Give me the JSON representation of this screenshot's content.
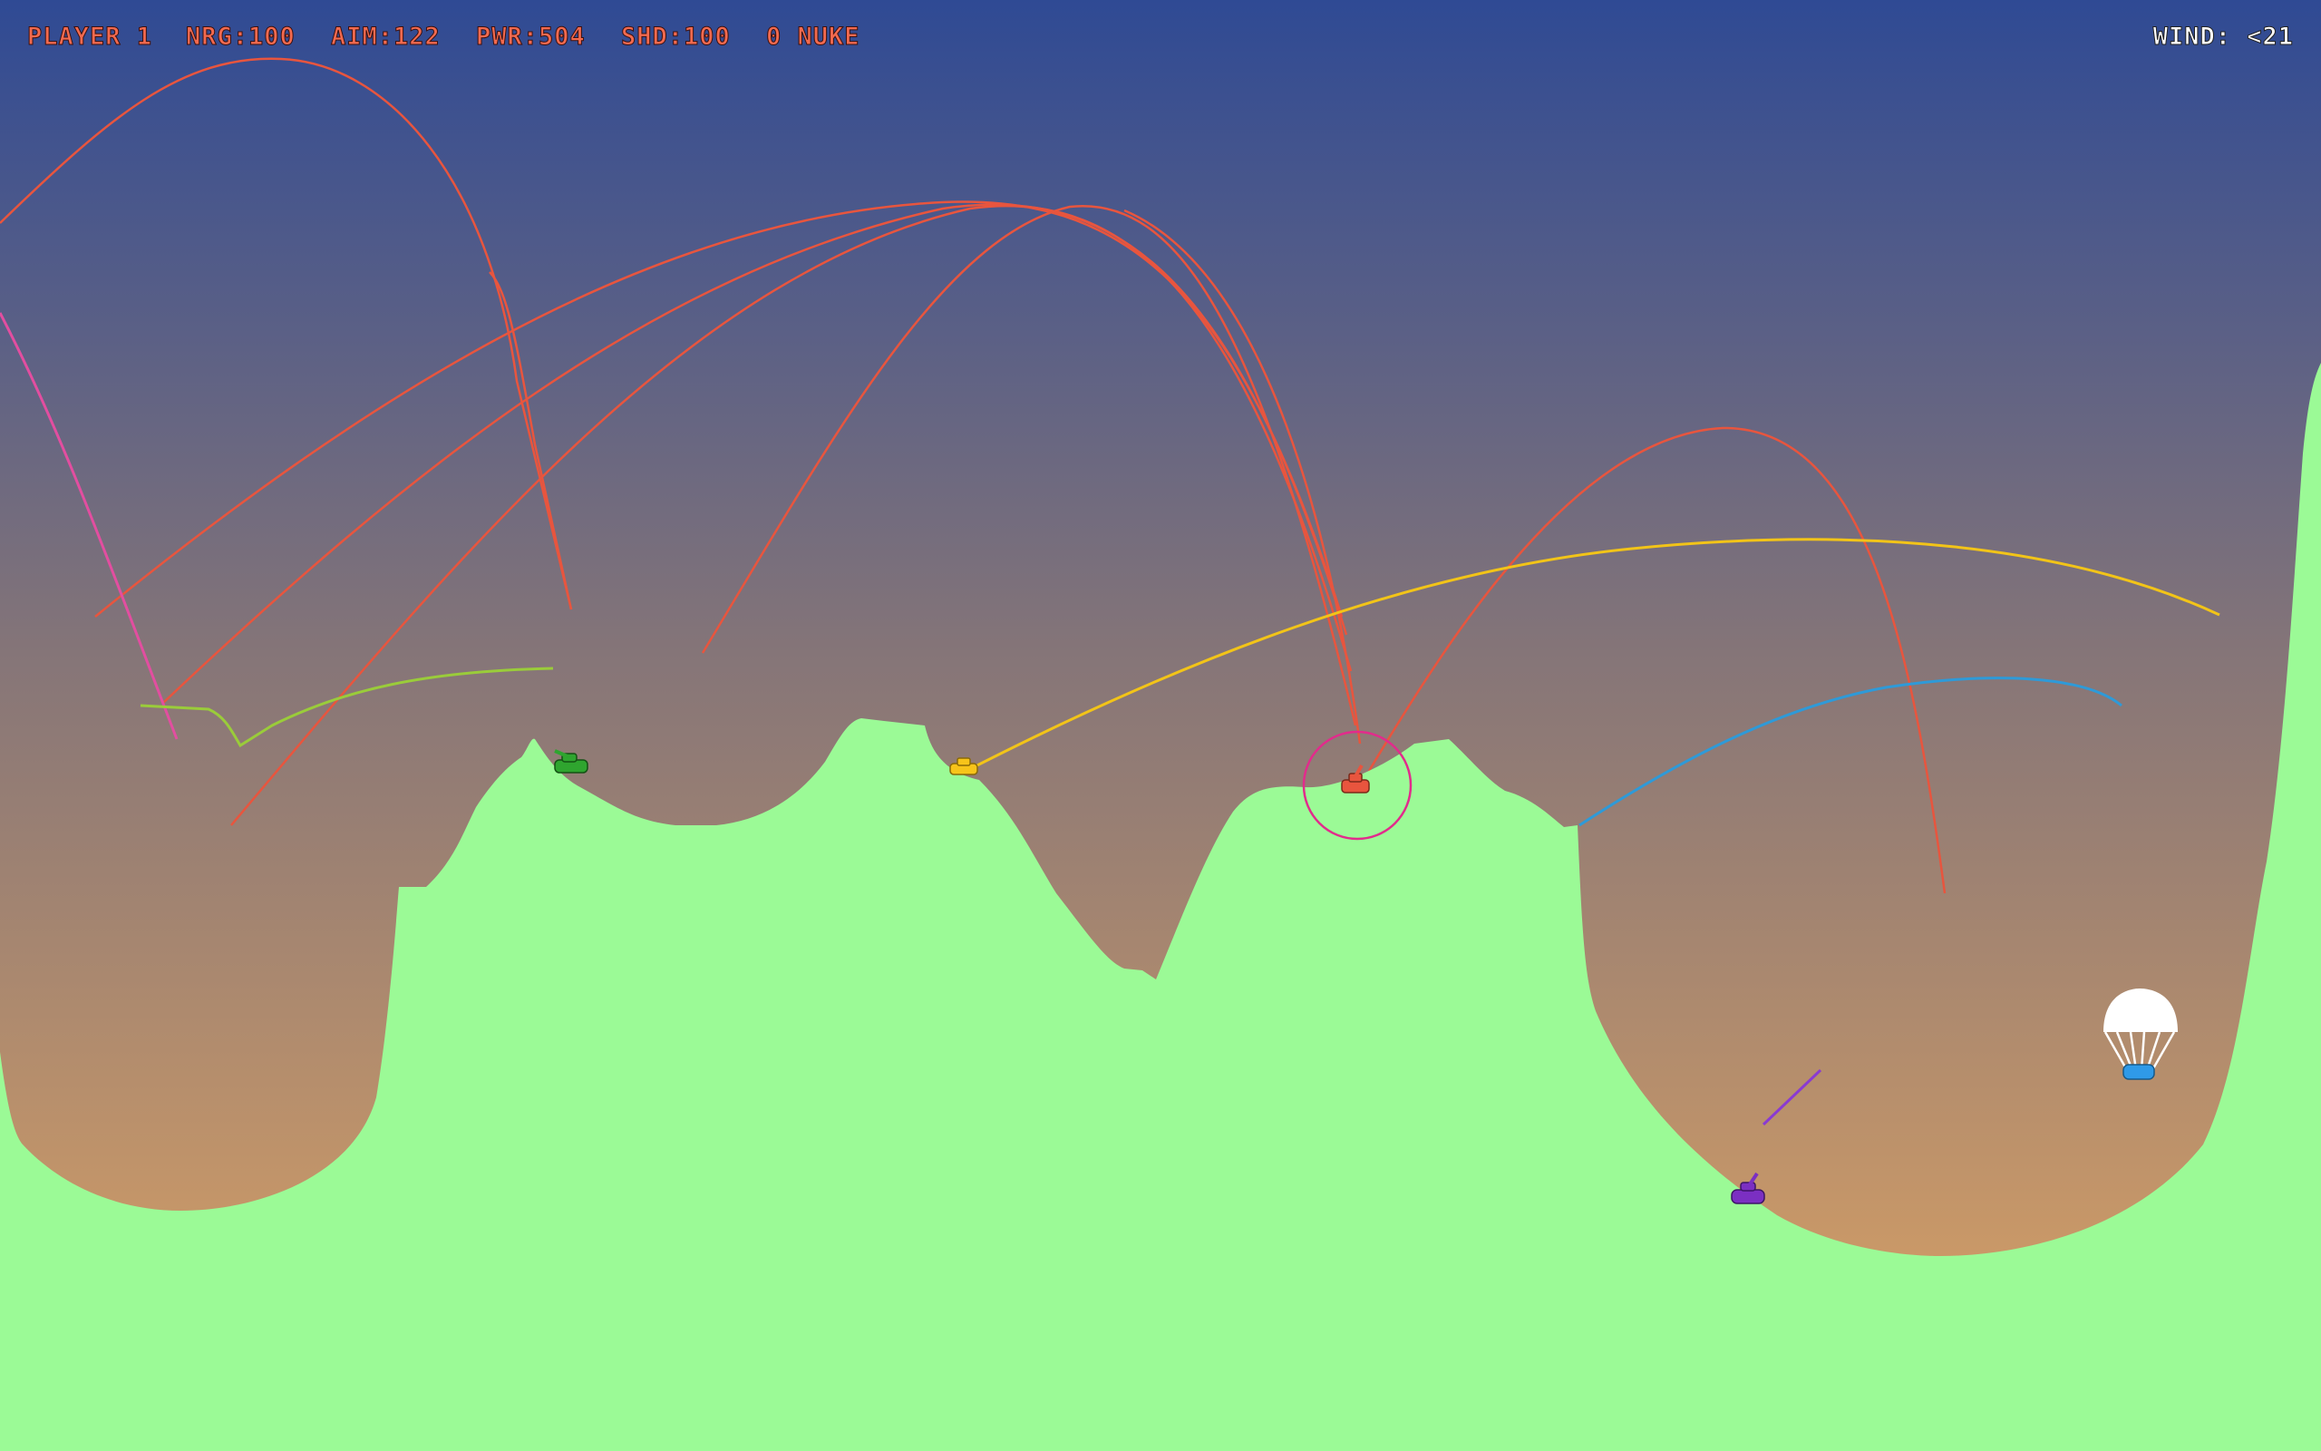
{
  "hud": {
    "player": "PLAYER 1",
    "energy": "NRG:100",
    "aim": "AIM:122",
    "power": "PWR:504",
    "shield": "SHD:100",
    "weapon": "0 NUKE",
    "wind": "WIND: <21"
  },
  "colors": {
    "hud_text": "#f26a4f",
    "wind_text": "#ffffff",
    "sky_top": "#2f4a94",
    "sky_mid": "#857578",
    "sky_bottom": "#dca062",
    "terrain": "#9bfa96",
    "player_1": "#e8553e",
    "player_green": "#2fa52f",
    "player_yellow": "#f7c41a",
    "player_purple": "#7b2fc2",
    "player_blue": "#2f9ae8",
    "shield": "#e22b8c"
  },
  "tanks": [
    {
      "name": "player-1-tank",
      "color": "#e8553e",
      "active": true
    },
    {
      "name": "green-tank",
      "color": "#2fa52f"
    },
    {
      "name": "yellow-tank",
      "color": "#f7c41a"
    },
    {
      "name": "purple-tank",
      "color": "#7b2fc2"
    },
    {
      "name": "blue-tank-parachuting",
      "color": "#2f9ae8",
      "parachute": true
    }
  ]
}
